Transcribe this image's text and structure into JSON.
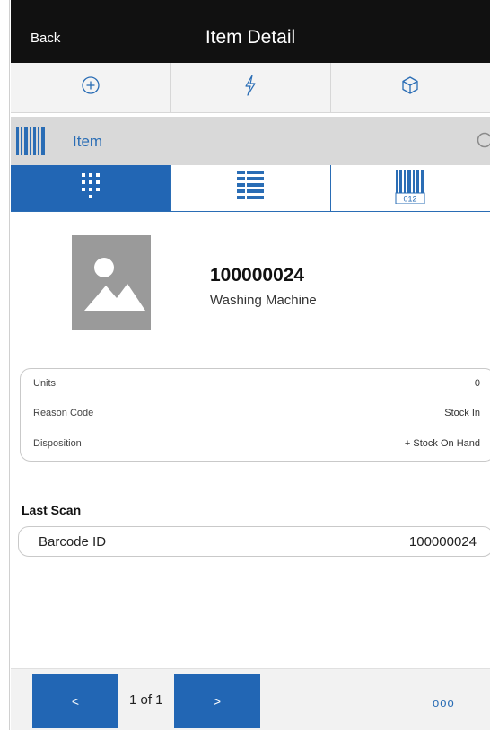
{
  "header": {
    "back_label": "Back",
    "title": "Item Detail"
  },
  "actions": [
    {
      "icon": "plus-circle-icon"
    },
    {
      "icon": "lightning-icon"
    },
    {
      "icon": "box-icon"
    }
  ],
  "item_bar": {
    "label": "Item",
    "icon": "barcode-icon",
    "search_icon": "search-icon"
  },
  "tabs": [
    {
      "icon": "dot-grid-icon",
      "active": true
    },
    {
      "icon": "list-icon",
      "active": false
    },
    {
      "icon": "barcode-012-icon",
      "active": false,
      "caption": "012"
    }
  ],
  "item": {
    "number": "100000024",
    "name": "Washing Machine",
    "image_icon": "image-placeholder-icon"
  },
  "details": [
    {
      "label": "Units",
      "value": "0"
    },
    {
      "label": "Reason Code",
      "value": "Stock In"
    },
    {
      "label": "Disposition",
      "value": "+ Stock On Hand"
    }
  ],
  "last_scan": {
    "title": "Last Scan",
    "label": "Barcode ID",
    "value": "100000024"
  },
  "footer": {
    "prev_label": "<",
    "pager_text": "1 of 1",
    "next_label": ">",
    "more_label": "ooo"
  },
  "colors": {
    "accent": "#2266b4",
    "header_bg": "#111111",
    "bar_bg": "#d9d9d9"
  }
}
